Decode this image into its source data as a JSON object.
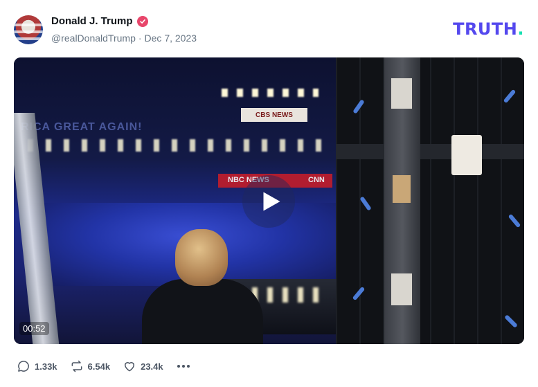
{
  "post": {
    "author_name": "Donald J. Trump",
    "handle": "@realDonaldTrump",
    "separator": "·",
    "date": "Dec 7, 2023"
  },
  "brand": {
    "logo_text": "TRUTH",
    "logo_dot": ".",
    "colors": {
      "logo": "#5448ee",
      "dot": "#17e0b2",
      "verified": "#e8466b"
    }
  },
  "video": {
    "duration": "00:52",
    "banner_text": "RICA GREAT AGAIN!",
    "sign_text": "CBS NEWS",
    "network_left": "NBC NEWS",
    "network_right": "CNN"
  },
  "actions": {
    "replies": "1.33k",
    "retruths": "6.54k",
    "likes": "23.4k"
  }
}
